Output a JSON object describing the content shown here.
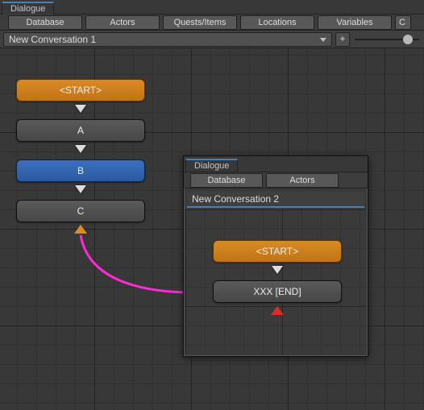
{
  "tabs": {
    "main": "Dialogue"
  },
  "toolbar": {
    "database": "Database",
    "actors": "Actors",
    "quests": "Quests/Items",
    "locations": "Locations",
    "variables": "Variables",
    "conversations_cut": "C"
  },
  "dropdown": {
    "conversation": "New Conversation 1",
    "plus": "+"
  },
  "nodes": {
    "start": "<START>",
    "a": "A",
    "b": "B",
    "c": "C"
  },
  "subwindow": {
    "tab": "Dialogue",
    "toolbar": {
      "database": "Database",
      "actors": "Actors"
    },
    "conversation": "New Conversation 2",
    "nodes": {
      "start": "<START>",
      "end": "XXX [END]"
    }
  },
  "colors": {
    "link_pink": "#ff2ad4"
  }
}
